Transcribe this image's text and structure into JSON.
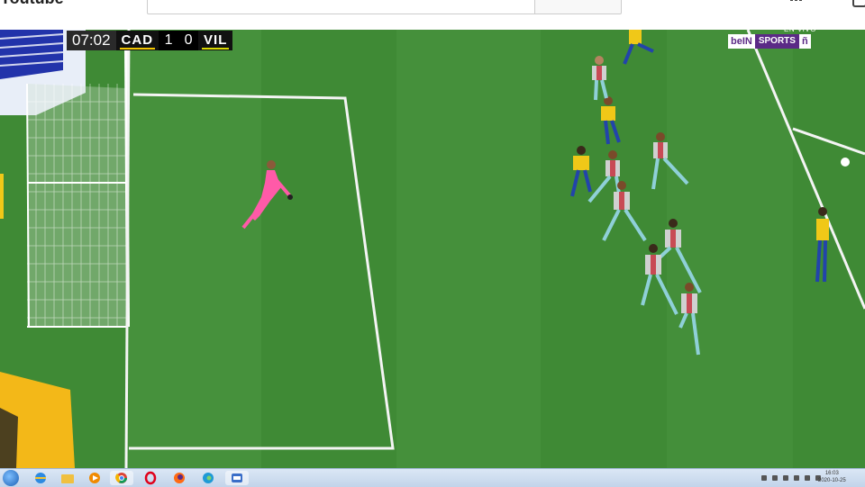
{
  "page": {
    "site_name": "Youtube",
    "search_placeholder": ""
  },
  "broadcast": {
    "clock": "07:02",
    "home_team": "CAD",
    "home_score": "1",
    "away_score": "0",
    "away_team": "VIL",
    "live_label": "EN VIVO",
    "brand_left": "beIN",
    "brand_middle": "SPORTS",
    "brand_right": "ñ"
  },
  "colors": {
    "pitch_light": "#4a9440",
    "pitch_dark": "#3f8a35",
    "home_kit": "#f0c818",
    "away_kit": "#d8d8d8",
    "keeper_kit": "#ff5aa8",
    "taskbar": "#c8d8ec"
  },
  "taskbar": {
    "icons": [
      "start-orb-icon",
      "ie-icon",
      "folder-icon",
      "media-player-icon",
      "chrome-icon",
      "opera-icon",
      "firefox-icon",
      "edge-icon",
      "app-icon"
    ],
    "date": "2020-10-25",
    "time": "16:03"
  }
}
